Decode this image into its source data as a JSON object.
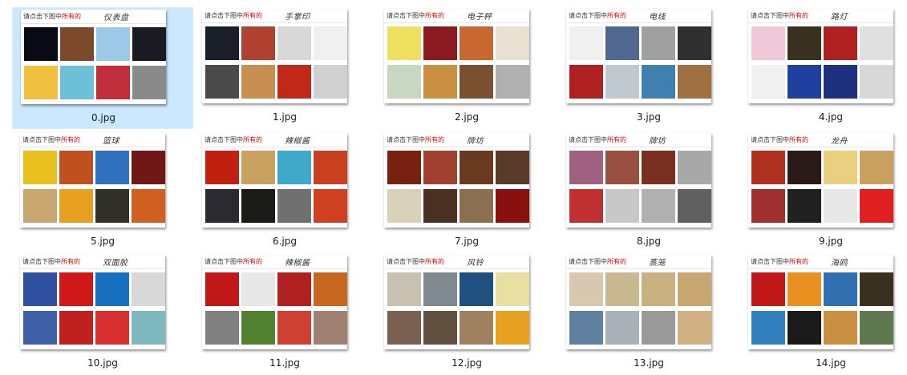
{
  "hint_prefix": "请点击下图中",
  "hint_emphasis": "所有的",
  "accent_color": "#e60000",
  "selected_color": "#cce8ff",
  "files": [
    {
      "name": "0.jpg",
      "target": "仪表盘",
      "selected": true,
      "pics": [
        "#0a0a14",
        "#7a4a2a",
        "#9ec8e8",
        "#1a1a22",
        "#f0c040",
        "#6cc0d8",
        "#c0303a",
        "#8a8a8a"
      ]
    },
    {
      "name": "1.jpg",
      "target": "手掌印",
      "selected": false,
      "pics": [
        "#1a1e28",
        "#b04030",
        "#d8d8d8",
        "#f0f0f0",
        "#4a4a4a",
        "#c89050",
        "#c02818",
        "#d0d0d0"
      ]
    },
    {
      "name": "2.jpg",
      "target": "电子秤",
      "selected": false,
      "pics": [
        "#f0e060",
        "#8a1a20",
        "#c86830",
        "#e8e0d0",
        "#c8d8c0",
        "#c89040",
        "#7a5030",
        "#b0b0b0"
      ]
    },
    {
      "name": "3.jpg",
      "target": "电线",
      "selected": false,
      "pics": [
        "#f0f0f0",
        "#506890",
        "#a0a0a0",
        "#303030",
        "#b02020",
        "#c0c8d0",
        "#4080b0",
        "#a07040"
      ]
    },
    {
      "name": "4.jpg",
      "target": "路灯",
      "selected": false,
      "pics": [
        "#f0c8d8",
        "#3a3020",
        "#b02020",
        "#e0e0e0",
        "#f0f0f0",
        "#2040a0",
        "#203080",
        "#d8d8d8"
      ]
    },
    {
      "name": "5.jpg",
      "target": "篮球",
      "selected": false,
      "pics": [
        "#e8c020",
        "#c05020",
        "#3070c0",
        "#701818",
        "#c8a870",
        "#e8a020",
        "#303028",
        "#d06020"
      ]
    },
    {
      "name": "6.jpg",
      "target": "辣椒酱",
      "selected": false,
      "pics": [
        "#c02010",
        "#c8a060",
        "#40a8c8",
        "#c84020",
        "#2a2a30",
        "#1a1a18",
        "#707070",
        "#d04020"
      ]
    },
    {
      "name": "7.jpg",
      "target": "牌坊",
      "selected": false,
      "pics": [
        "#7a2010",
        "#a04030",
        "#6a3a20",
        "#5a3a28",
        "#d8d0b8",
        "#4a3020",
        "#8a7050",
        "#8a1010"
      ]
    },
    {
      "name": "8.jpg",
      "target": "牌坊",
      "selected": false,
      "pics": [
        "#a06080",
        "#9a5040",
        "#7a3020",
        "#a8a8a8",
        "#c03030",
        "#c8c8c8",
        "#b0b0b0",
        "#606060"
      ]
    },
    {
      "name": "9.jpg",
      "target": "龙舟",
      "selected": false,
      "pics": [
        "#b03020",
        "#2a1a1a",
        "#e8d080",
        "#c8a060",
        "#a03030",
        "#202020",
        "#e8e8e8",
        "#e02020"
      ]
    },
    {
      "name": "10.jpg",
      "target": "双面胶",
      "selected": false,
      "pics": [
        "#3050a0",
        "#d01818",
        "#1870c0",
        "#d8d8d8",
        "#4060a8",
        "#c02020",
        "#d83030",
        "#80b8c0"
      ]
    },
    {
      "name": "11.jpg",
      "target": "辣椒酱",
      "selected": false,
      "pics": [
        "#c01818",
        "#e8e8e8",
        "#b02020",
        "#c86820",
        "#808080",
        "#508030",
        "#d04030",
        "#a08070"
      ]
    },
    {
      "name": "12.jpg",
      "target": "风铃",
      "selected": false,
      "pics": [
        "#c8c0b0",
        "#808890",
        "#205080",
        "#e8e0a0",
        "#7a6050",
        "#605040",
        "#a08060",
        "#e8a020"
      ]
    },
    {
      "name": "13.jpg",
      "target": "蒸笼",
      "selected": false,
      "pics": [
        "#d8c8b0",
        "#c8b890",
        "#c8b080",
        "#c8a870",
        "#6080a0",
        "#a8b0b8",
        "#9a9a9a",
        "#d0b080"
      ]
    },
    {
      "name": "14.jpg",
      "target": "海鸥",
      "selected": false,
      "pics": [
        "#c01818",
        "#e89020",
        "#3070b0",
        "#3a3020",
        "#3080c0",
        "#1a1a1a",
        "#c89040",
        "#607850"
      ]
    }
  ]
}
